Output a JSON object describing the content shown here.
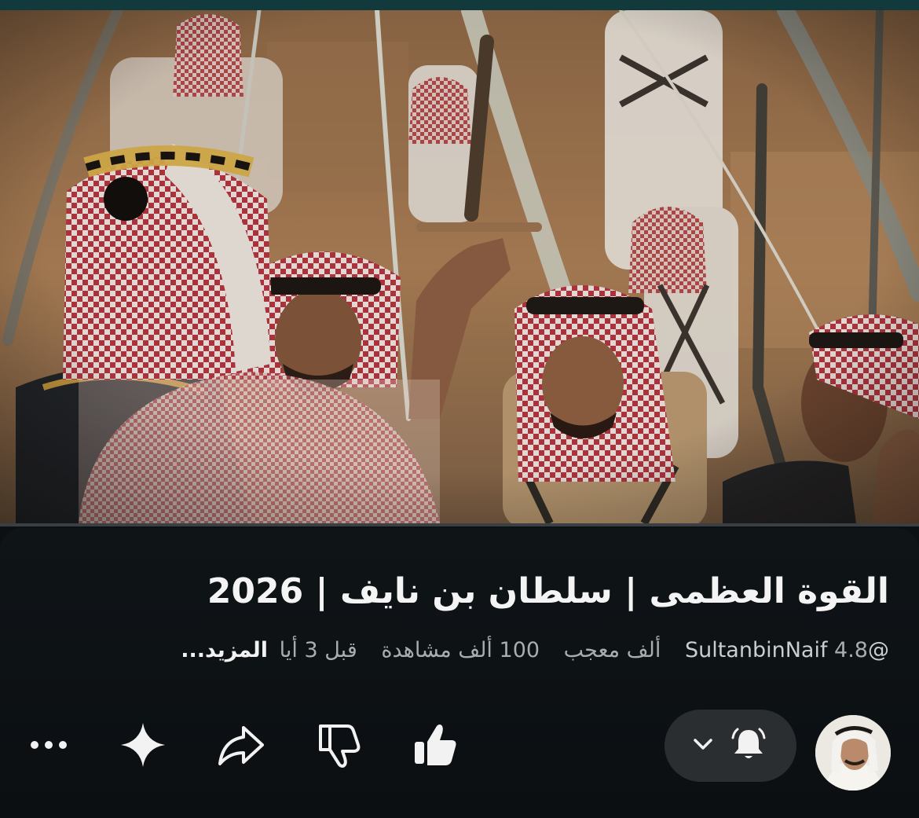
{
  "video": {
    "title": "القوة العظمى | سلطان بن نايف | 2026",
    "progress": 0
  },
  "meta": {
    "channel_handle": "@SultanbinNaif",
    "likes": "4.8 ألف معجب",
    "views": "100 ألف مشاهدة",
    "time_ago": "قبل 3 أيا",
    "more_label": "المزيد..."
  },
  "actions": {
    "items": [
      {
        "name": "like",
        "icon": "thumbs-up-icon"
      },
      {
        "name": "dislike",
        "icon": "thumbs-down-icon"
      },
      {
        "name": "share",
        "icon": "share-arrow-icon"
      },
      {
        "name": "ask",
        "icon": "sparkle-icon"
      },
      {
        "name": "more",
        "icon": "more-dots-icon"
      }
    ],
    "subscribe_icons": [
      "bell-ringing-icon",
      "chevron-down-icon"
    ]
  },
  "colors": {
    "background": "#0c1013",
    "title": "#f4f4f4",
    "meta": "#a8adb1",
    "pill": "#2a2e31"
  }
}
